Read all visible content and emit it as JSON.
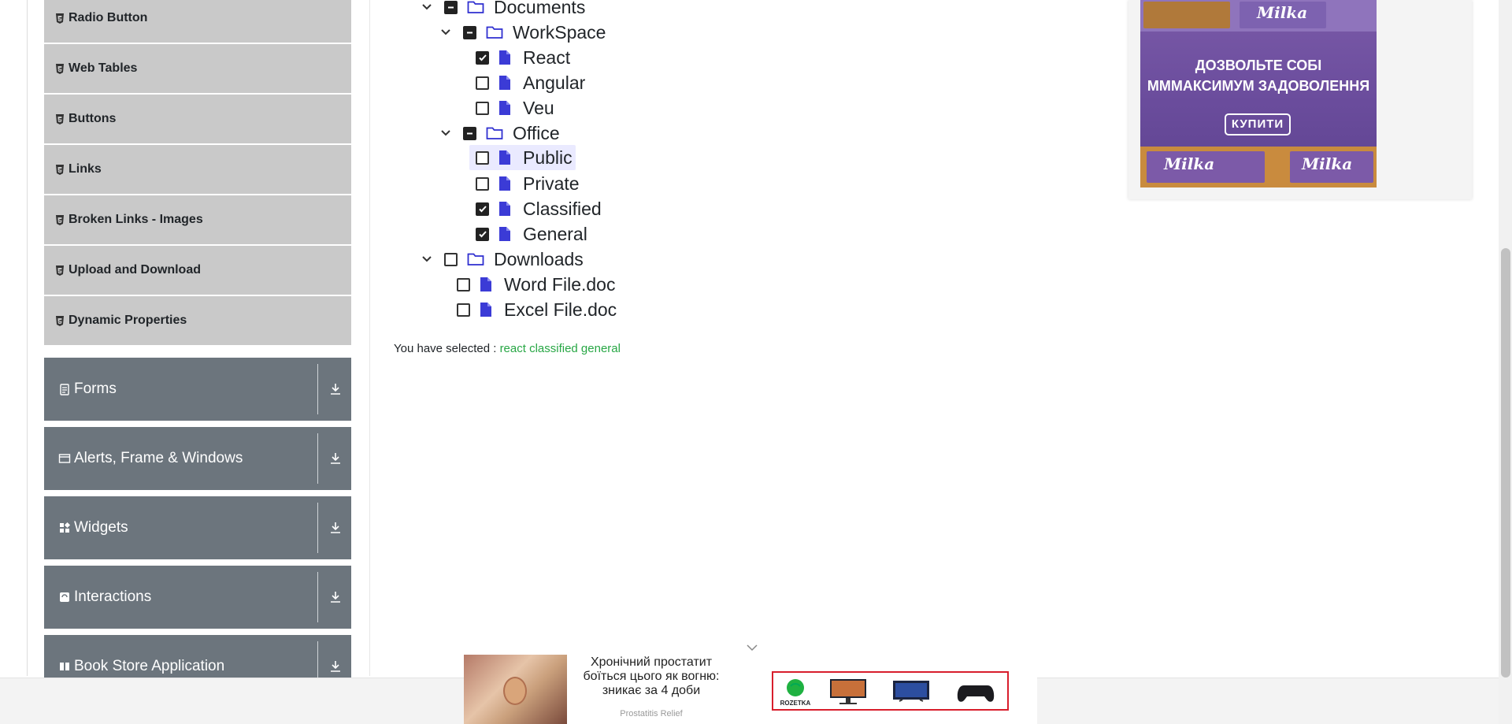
{
  "sidebar": {
    "sub_items": [
      {
        "label": "Radio Button"
      },
      {
        "label": "Web Tables"
      },
      {
        "label": "Buttons"
      },
      {
        "label": "Links"
      },
      {
        "label": "Broken Links - Images"
      },
      {
        "label": "Upload and Download"
      },
      {
        "label": "Dynamic Properties"
      }
    ],
    "groups": [
      {
        "label": "Forms",
        "icon": "form-icon"
      },
      {
        "label": "Alerts, Frame & Windows",
        "icon": "window-icon"
      },
      {
        "label": "Widgets",
        "icon": "widgets-icon"
      },
      {
        "label": "Interactions",
        "icon": "interactions-icon"
      },
      {
        "label": "Book Store Application",
        "icon": "book-icon"
      }
    ]
  },
  "tree": {
    "nodes": [
      {
        "label": "Documents",
        "type": "folder",
        "state": "half",
        "expanded": true
      },
      {
        "label": "WorkSpace",
        "type": "folder",
        "state": "half",
        "expanded": true
      },
      {
        "label": "React",
        "type": "file",
        "state": "checked"
      },
      {
        "label": "Angular",
        "type": "file",
        "state": "unchecked"
      },
      {
        "label": "Veu",
        "type": "file",
        "state": "unchecked"
      },
      {
        "label": "Office",
        "type": "folder",
        "state": "half",
        "expanded": true
      },
      {
        "label": "Public",
        "type": "file",
        "state": "unchecked",
        "highlighted": true
      },
      {
        "label": "Private",
        "type": "file",
        "state": "unchecked"
      },
      {
        "label": "Classified",
        "type": "file",
        "state": "checked"
      },
      {
        "label": "General",
        "type": "file",
        "state": "checked"
      },
      {
        "label": "Downloads",
        "type": "folder",
        "state": "unchecked",
        "expanded": true
      },
      {
        "label": "Word File.doc",
        "type": "file",
        "state": "unchecked"
      },
      {
        "label": "Excel File.doc",
        "type": "file",
        "state": "unchecked"
      }
    ]
  },
  "result": {
    "prefix": "You have selected :",
    "values": "react classified general"
  },
  "side_ad": {
    "headline_line1": "ДОЗВОЛЬТЕ СОБІ",
    "headline_line2": "МММАКСИМУМ ЗАДОВОЛЕННЯ",
    "button": "КУПИТИ",
    "brand": "Milka"
  },
  "bottom_ad": {
    "text": "Хронічний простатит боїться цього як вогню: зникає за 4 доби",
    "sponsor": "Prostatitis Relief",
    "store": "ROZETKA"
  },
  "colors": {
    "sidebar_item_bg": "#c9c9c9",
    "group_bg": "#6c757d",
    "success": "#28a745",
    "file_icon": "#3b3bd6"
  }
}
